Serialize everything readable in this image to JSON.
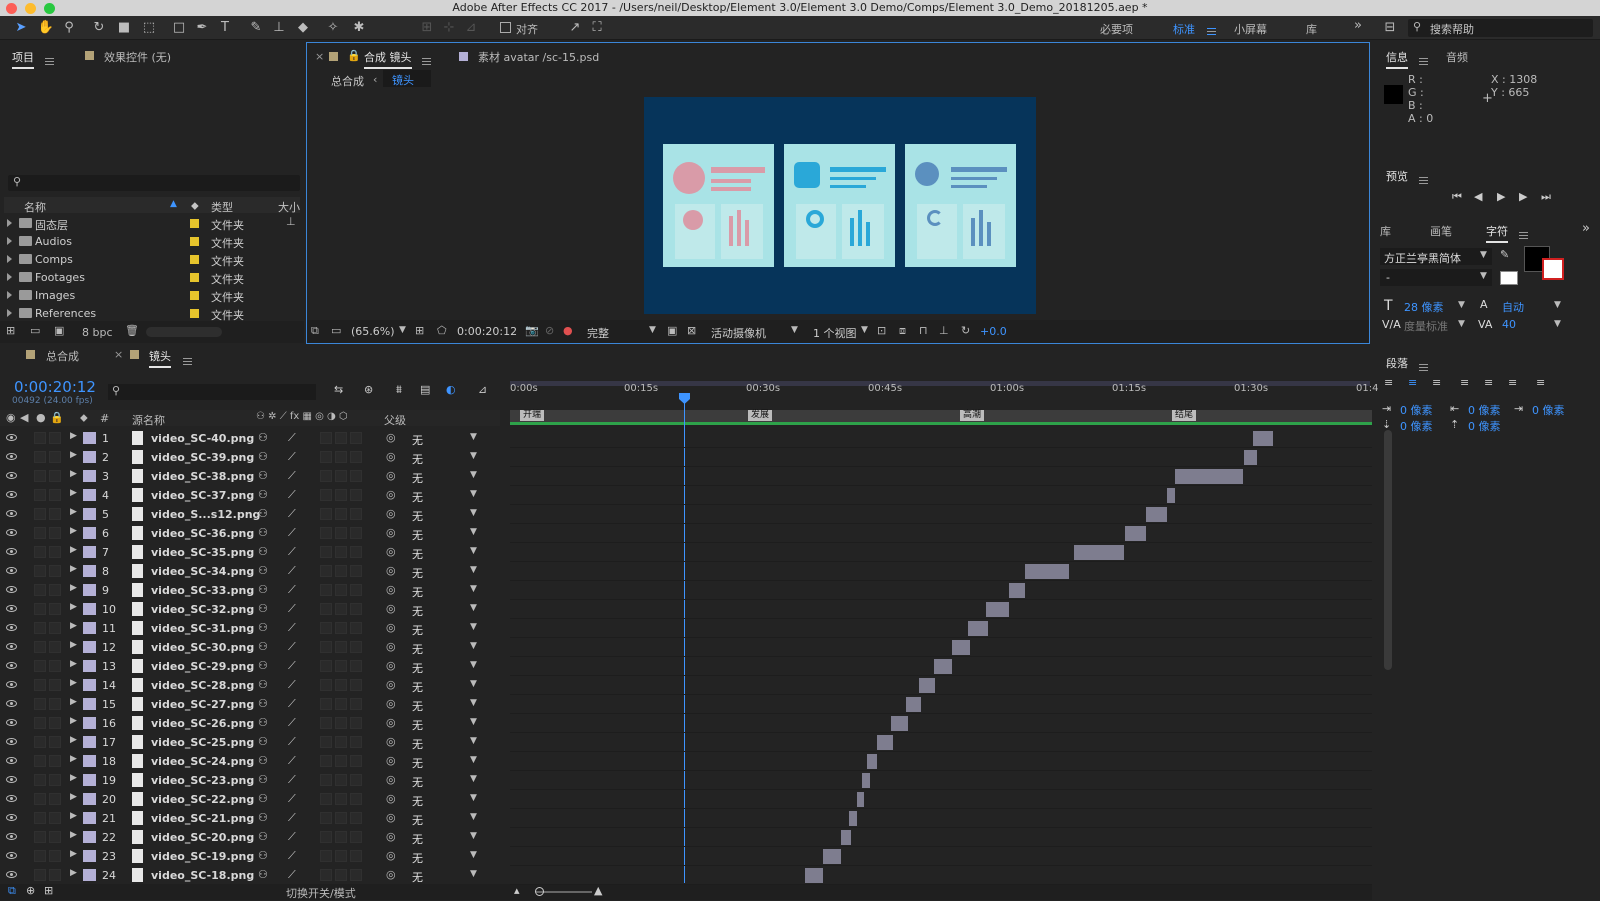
{
  "title": "Adobe After Effects CC 2017 - /Users/neil/Desktop/Element 3.0/Element 3.0 Demo/Comps/Element 3.0_Demo_20181205.aep *",
  "toolbar": {
    "snap_label": "对齐",
    "workspaces": [
      "必要项",
      "标准",
      "小屏幕",
      "库"
    ],
    "active_workspace": "标准",
    "search_placeholder": "搜索帮助"
  },
  "project": {
    "tab": "项目",
    "effects_tab": "效果控件 (无)",
    "search_placeholder": "",
    "col_name": "名称",
    "col_type": "类型",
    "col_size": "大小",
    "items": [
      {
        "name": "固态层",
        "type": "文件夹"
      },
      {
        "name": "Audios",
        "type": "文件夹"
      },
      {
        "name": "Comps",
        "type": "文件夹"
      },
      {
        "name": "Footages",
        "type": "文件夹"
      },
      {
        "name": "Images",
        "type": "文件夹"
      },
      {
        "name": "References",
        "type": "文件夹"
      }
    ],
    "bpc": "8 bpc"
  },
  "comp_viewer": {
    "tab": "合成 镜头",
    "footage_tab": "素材 avatar /sc-15.psd",
    "breadcrumb": [
      "总合成",
      "镜头"
    ],
    "zoom": "(65.6%)",
    "timecode": "0:00:20:12",
    "resolution": "完整",
    "camera": "活动摄像机",
    "views": "1 个视图",
    "exposure": "+0.0"
  },
  "info": {
    "tab": "信息",
    "audio_tab": "音频",
    "r": "R :",
    "g": "G :",
    "b": "B :",
    "a": "A : 0",
    "x": "X : 1308",
    "y": "Y : 665"
  },
  "preview": {
    "tab": "预览"
  },
  "character": {
    "tabs": [
      "库",
      "画笔",
      "字符"
    ],
    "font": "方正兰亭黑简体",
    "style": "-",
    "size": "28 像素",
    "leading": "自动",
    "kerning": "度量标准",
    "tracking": "40"
  },
  "paragraph": {
    "tab": "段落",
    "indent1": "0 像素",
    "indent2": "0 像素",
    "indent3": "0 像素",
    "space1": "0 像素",
    "space2": "0 像素"
  },
  "timeline": {
    "tabs": [
      "总合成",
      "镜头"
    ],
    "timecode": "0:00:20:12",
    "frames": "00492 (24.00 fps)",
    "col_num": "#",
    "col_source": "源名称",
    "col_parent": "父级",
    "ruler": [
      "0:00s",
      "00:15s",
      "00:30s",
      "00:45s",
      "01:00s",
      "01:15s",
      "01:30s",
      "01:4"
    ],
    "markers": [
      "开端",
      "发展",
      "高潮",
      "结尾"
    ],
    "toggle_label": "切换开关/模式",
    "layers": [
      {
        "num": "1",
        "name": "video_SC-40.png",
        "parent": "无",
        "in": 91.2,
        "out": 93.6
      },
      {
        "num": "2",
        "name": "video_SC-39.png",
        "parent": "无",
        "in": 90.0,
        "out": 91.6
      },
      {
        "num": "3",
        "name": "video_SC-38.png",
        "parent": "无",
        "in": 81.6,
        "out": 90.0
      },
      {
        "num": "4",
        "name": "video_SC-37.png",
        "parent": "无",
        "in": 80.6,
        "out": 81.6
      },
      {
        "num": "5",
        "name": "video_S...s12.png",
        "parent": "无",
        "in": 78.0,
        "out": 80.6
      },
      {
        "num": "6",
        "name": "video_SC-36.png",
        "parent": "无",
        "in": 75.4,
        "out": 78.0
      },
      {
        "num": "7",
        "name": "video_SC-35.png",
        "parent": "无",
        "in": 69.2,
        "out": 75.4
      },
      {
        "num": "8",
        "name": "video_SC-34.png",
        "parent": "无",
        "in": 63.2,
        "out": 68.6
      },
      {
        "num": "9",
        "name": "video_SC-33.png",
        "parent": "无",
        "in": 61.2,
        "out": 63.2
      },
      {
        "num": "10",
        "name": "video_SC-32.png",
        "parent": "无",
        "in": 58.4,
        "out": 61.2
      },
      {
        "num": "11",
        "name": "video_SC-31.png",
        "parent": "无",
        "in": 56.2,
        "out": 58.6
      },
      {
        "num": "12",
        "name": "video_SC-30.png",
        "parent": "无",
        "in": 54.2,
        "out": 56.4
      },
      {
        "num": "13",
        "name": "video_SC-29.png",
        "parent": "无",
        "in": 52.0,
        "out": 54.2
      },
      {
        "num": "14",
        "name": "video_SC-28.png",
        "parent": "无",
        "in": 50.2,
        "out": 52.2
      },
      {
        "num": "15",
        "name": "video_SC-27.png",
        "parent": "无",
        "in": 48.6,
        "out": 50.4
      },
      {
        "num": "16",
        "name": "video_SC-26.png",
        "parent": "无",
        "in": 46.8,
        "out": 48.8
      },
      {
        "num": "17",
        "name": "video_SC-25.png",
        "parent": "无",
        "in": 45.0,
        "out": 47.0
      },
      {
        "num": "18",
        "name": "video_SC-24.png",
        "parent": "无",
        "in": 43.8,
        "out": 45.0
      },
      {
        "num": "19",
        "name": "video_SC-23.png",
        "parent": "无",
        "in": 43.2,
        "out": 44.2
      },
      {
        "num": "20",
        "name": "video_SC-22.png",
        "parent": "无",
        "in": 42.6,
        "out": 43.4
      },
      {
        "num": "21",
        "name": "video_SC-21.png",
        "parent": "无",
        "in": 41.6,
        "out": 42.6
      },
      {
        "num": "22",
        "name": "video_SC-20.png",
        "parent": "无",
        "in": 40.6,
        "out": 41.8
      },
      {
        "num": "23",
        "name": "video_SC-19.png",
        "parent": "无",
        "in": 38.4,
        "out": 40.6
      },
      {
        "num": "24",
        "name": "video_SC-18.png",
        "parent": "无",
        "in": 36.2,
        "out": 38.4
      }
    ]
  }
}
